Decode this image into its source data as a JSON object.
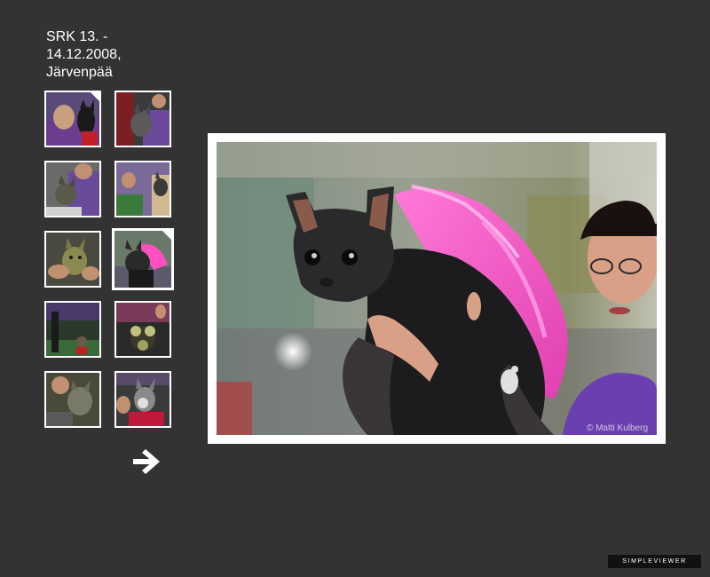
{
  "gallery": {
    "title": "SRK 13. - 14.12.2008, Järvenpää"
  },
  "thumbnails": {
    "count": 10,
    "selected_index": 5
  },
  "main_image": {
    "credit": "© Matti Kulberg"
  },
  "navigation": {
    "next_icon": "arrow-right-icon"
  },
  "branding": {
    "label": "SIMPLEVIEWER"
  },
  "colors": {
    "background": "#333333",
    "frame": "#ffffff",
    "brand_bg": "#111111"
  }
}
